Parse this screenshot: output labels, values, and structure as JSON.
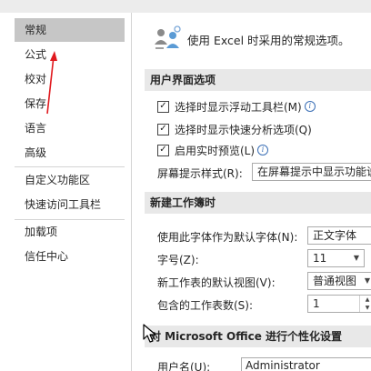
{
  "nav": {
    "items": [
      {
        "label": "常规",
        "selected": true
      },
      {
        "label": "公式"
      },
      {
        "label": "校对"
      },
      {
        "label": "保存"
      },
      {
        "label": "语言"
      },
      {
        "label": "高级"
      },
      {
        "label": "自定义功能区"
      },
      {
        "label": "快速访问工具栏"
      },
      {
        "label": "加载项"
      },
      {
        "label": "信任中心"
      }
    ]
  },
  "header": {
    "icon": "settings-people-icon",
    "text": "使用 Excel 时采用的常规选项。"
  },
  "ui_options": {
    "title": "用户界面选项",
    "checks": [
      {
        "label": "选择时显示浮动工具栏(M)",
        "checked": true,
        "info": true
      },
      {
        "label": "选择时显示快速分析选项(Q)",
        "checked": true,
        "info": false
      },
      {
        "label": "启用实时预览(L)",
        "checked": true,
        "info": true
      }
    ],
    "screentip_label": "屏幕提示样式(R):",
    "screentip_value": "在屏幕提示中显示功能说"
  },
  "new_workbook": {
    "title": "新建工作簿时",
    "font_label": "使用此字体作为默认字体(N):",
    "font_value": "正文字体",
    "size_label": "字号(Z):",
    "size_value": "11",
    "view_label": "新工作表的默认视图(V):",
    "view_value": "普通视图",
    "sheets_label": "包含的工作表数(S):",
    "sheets_value": "1"
  },
  "personalize": {
    "title": "对 Microsoft Office 进行个性化设置",
    "username_label": "用户名(U):",
    "username_value": "Administrator"
  },
  "colors": {
    "selected_nav": "#c6c6c6",
    "section_band": "#e8e8e8",
    "arrow": "#e0191e",
    "info_blue": "#3b6fb6"
  }
}
